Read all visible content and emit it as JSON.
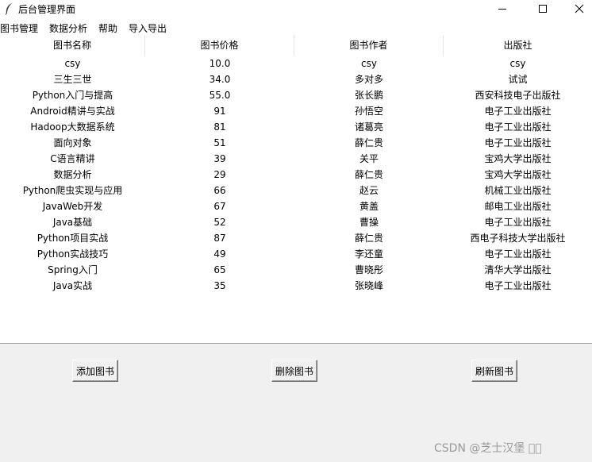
{
  "window": {
    "title": "后台管理界面",
    "icon": "feather-icon",
    "controls": [
      "minimize-icon",
      "maximize-icon",
      "close-icon"
    ]
  },
  "menu": {
    "items": [
      {
        "label": "图书管理"
      },
      {
        "label": "数据分析"
      },
      {
        "label": "帮助"
      },
      {
        "label": "导入导出"
      }
    ]
  },
  "table": {
    "columns": [
      "图书名称",
      "图书价格",
      "图书作者",
      "出版社"
    ],
    "rows": [
      [
        "csy",
        "10.0",
        "csy",
        "csy"
      ],
      [
        "三生三世",
        "34.0",
        "多对多",
        "试试"
      ],
      [
        "Python入门与提高",
        "55.0",
        "张长鹏",
        "西安科技电子出版社"
      ],
      [
        "Android精讲与实战",
        "91",
        "孙悟空",
        "电子工业出版社"
      ],
      [
        "Hadoop大数据系统",
        "81",
        "诸葛亮",
        "电子工业出版社"
      ],
      [
        "面向对象",
        "51",
        "薛仁贵",
        "电子工业出版社"
      ],
      [
        "C语言精讲",
        "39",
        "关平",
        "宝鸡大学出版社"
      ],
      [
        "数据分析",
        "29",
        "薛仁贵",
        "宝鸡大学出版社"
      ],
      [
        "Python爬虫实现与应用",
        "66",
        "赵云",
        "机械工业出版社"
      ],
      [
        "JavaWeb开发",
        "67",
        "黄盖",
        "邮电工业出版社"
      ],
      [
        "Java基础",
        "52",
        "曹操",
        "电子工业出版社"
      ],
      [
        "Python项目实战",
        "87",
        "薛仁贵",
        "西电子科技大学出版社"
      ],
      [
        "Python实战技巧",
        "49",
        "李还童",
        "电子工业出版社"
      ],
      [
        "Spring入门",
        "65",
        "曹晓彤",
        "清华大学出版社"
      ],
      [
        "Java实战",
        "35",
        "张晓峰",
        "电子工业出版社"
      ]
    ]
  },
  "buttons": {
    "add": "添加图书",
    "delete": "删除图书",
    "refresh": "刷新图书"
  },
  "watermark": "CSDN @芝士汉堡 ￿￿"
}
